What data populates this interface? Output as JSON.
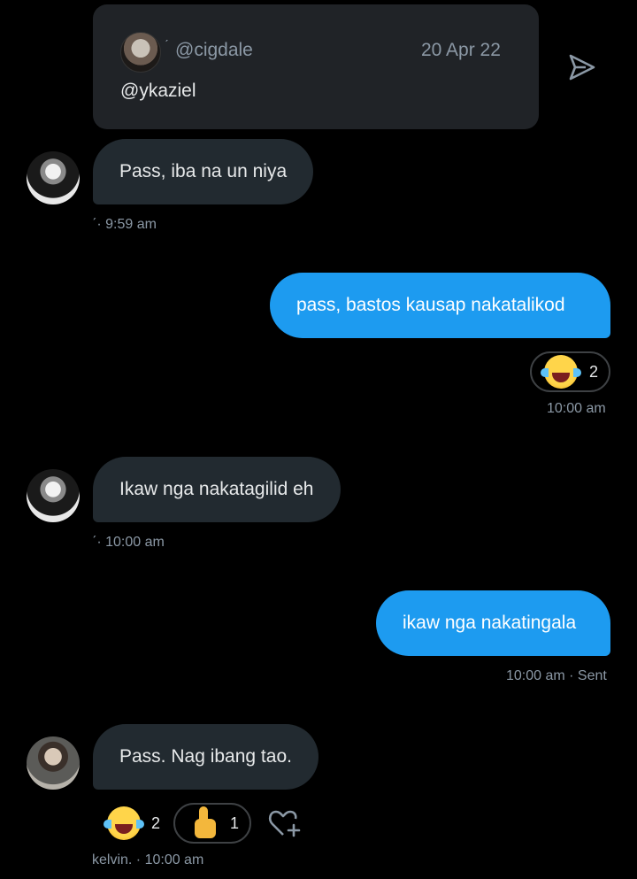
{
  "quote": {
    "tick": "ˊ",
    "handle": "@cigdale",
    "date": "20 Apr 22",
    "text": "@ykaziel"
  },
  "messages": [
    {
      "text": "Pass, iba na un niya",
      "meta": "ˊ· 9:59 am"
    },
    {
      "text": "pass, bastos kausap nakatalikod",
      "reaction_count": "2",
      "meta": "10:00 am"
    },
    {
      "text": "Ikaw nga nakatagilid eh",
      "meta": "ˊ· 10:00 am"
    },
    {
      "text": "ikaw nga nakatingala",
      "meta": "10:00 am · Sent"
    },
    {
      "text": "Pass. Nag ibang tao.",
      "reaction_laugh_count": "2",
      "reaction_thumb_count": "1",
      "meta": "kelvin. · 10:00 am"
    }
  ],
  "icons": {
    "share": "send-icon",
    "laugh": "face-with-tears-of-joy",
    "thumbs": "thumbs-up",
    "add_reaction": "heart-plus-icon"
  },
  "colors": {
    "background": "#000000",
    "incoming_bubble": "#222a30",
    "outgoing_bubble": "#1d9bf0",
    "muted_text": "#8b98a5"
  }
}
